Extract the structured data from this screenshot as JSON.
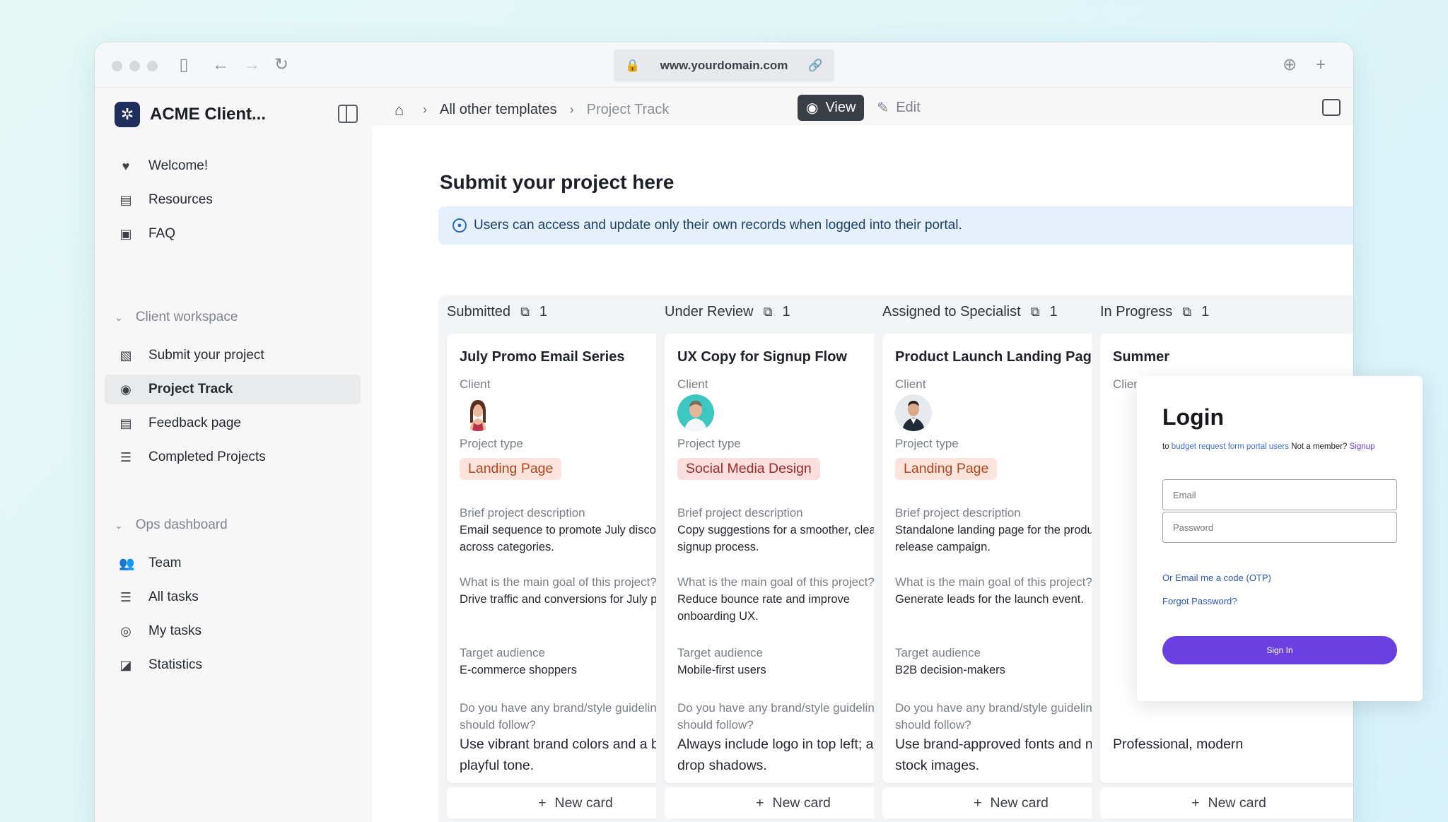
{
  "browser": {
    "url": "www.yourdomain.com"
  },
  "sidebar": {
    "app_name": "ACME Client...",
    "items_top": [
      {
        "label": "Welcome!",
        "icon": "heart-icon"
      },
      {
        "label": "Resources",
        "icon": "document-icon"
      },
      {
        "label": "FAQ",
        "icon": "book-icon"
      }
    ],
    "client_section": {
      "label": "Client workspace",
      "items": [
        {
          "label": "Submit your project",
          "icon": "file-add-icon"
        },
        {
          "label": "Project Track",
          "icon": "eye-icon",
          "active": true
        },
        {
          "label": "Feedback page",
          "icon": "message-icon"
        },
        {
          "label": "Completed Projects",
          "icon": "database-icon"
        }
      ]
    },
    "ops_section": {
      "label": "Ops dashboard",
      "items": [
        {
          "label": "Team",
          "icon": "users-icon"
        },
        {
          "label": "All tasks",
          "icon": "table-icon"
        },
        {
          "label": "My tasks",
          "icon": "user-scan-icon"
        },
        {
          "label": "Statistics",
          "icon": "chart-icon"
        }
      ]
    }
  },
  "header": {
    "breadcrumb": [
      "All other templates",
      "Project Track"
    ],
    "view_label": "View",
    "edit_label": "Edit"
  },
  "main": {
    "title": "Submit your project here",
    "notice": "Users can access and update only their own records when logged into their portal."
  },
  "labels": {
    "client": "Client",
    "project_type": "Project type",
    "brief": "Brief project description",
    "goal": "What is the main goal of this project?",
    "audience": "Target audience",
    "guidelines": "Do you have any brand/style guidelines we should follow?",
    "new_card": "New card"
  },
  "columns": [
    {
      "title": "Submitted",
      "count": "1",
      "card": {
        "title": "July Promo Email Series",
        "project_type": "Landing Page",
        "brief": "Email sequence to promote July discounts across categories.",
        "goal": "Drive traffic and conversions for July promo.",
        "audience": "E-commerce shoppers",
        "guidelines": "Use vibrant brand colors and a bold, playful tone."
      }
    },
    {
      "title": "Under Review",
      "count": "1",
      "card": {
        "title": "UX Copy for Signup Flow",
        "project_type": "Social Media Design",
        "brief": "Copy suggestions for a smoother, clearer signup process.",
        "goal": "Reduce bounce rate and improve onboarding UX.",
        "audience": "Mobile-first users",
        "guidelines": "Always include logo in top left; avoid drop shadows."
      }
    },
    {
      "title": "Assigned to Specialist",
      "count": "1",
      "card": {
        "title": "Product Launch Landing Page",
        "project_type": "Landing Page",
        "brief": "Standalone landing page for the product release campaign.",
        "goal": "Generate leads for the launch event.",
        "audience": "B2B decision-makers",
        "guidelines": "Use brand-approved fonts and no stock images."
      }
    },
    {
      "title": "In Progress",
      "count": "1",
      "card": {
        "title": "Summer",
        "project_type": "",
        "brief": "",
        "goal": "",
        "audience": "",
        "guidelines": "Professional, modern"
      }
    }
  ],
  "login": {
    "title": "Login",
    "sub_prefix": "to",
    "sub_link": "budget request form portal users",
    "sub_member": "Not a member?",
    "sub_signup": "Signup",
    "email_placeholder": "Email",
    "password_placeholder": "Password",
    "otp_link": "Or Email me a code (OTP)",
    "forgot_link": "Forgot Password?",
    "signin_label": "Sign In",
    "accent_color": "#6a41e0"
  }
}
